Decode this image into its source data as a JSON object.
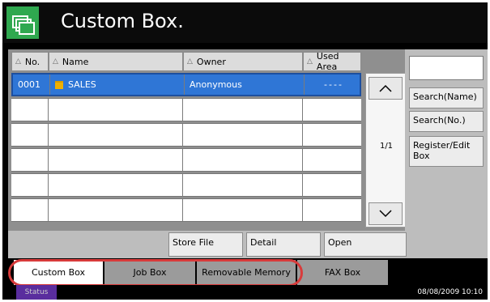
{
  "title": "Custom Box.",
  "table": {
    "headers": [
      "No.",
      "Name",
      "Owner",
      "Used Area"
    ],
    "rows": [
      {
        "no": "0001",
        "name": "SALES",
        "owner": "Anonymous",
        "used": "----"
      },
      {
        "no": "",
        "name": "",
        "owner": "",
        "used": ""
      },
      {
        "no": "",
        "name": "",
        "owner": "",
        "used": ""
      },
      {
        "no": "",
        "name": "",
        "owner": "",
        "used": ""
      },
      {
        "no": "",
        "name": "",
        "owner": "",
        "used": ""
      },
      {
        "no": "",
        "name": "",
        "owner": "",
        "used": ""
      }
    ],
    "page": "1/1"
  },
  "side_buttons": {
    "search_name": "Search(Name)",
    "search_no": "Search(No.)",
    "register_edit": "Register/Edit\nBox"
  },
  "action_buttons": {
    "store_file": "Store File",
    "detail": "Detail",
    "open": "Open"
  },
  "tabs": [
    "Custom Box",
    "Job Box",
    "Removable Memory",
    "FAX Box"
  ],
  "status": {
    "label": "Status",
    "datetime": "08/08/2009  10:10"
  },
  "colors": {
    "selected_row": "#2f76d6",
    "brand_icon": "#2fa84f",
    "highlight_oval": "#d83b3b"
  }
}
